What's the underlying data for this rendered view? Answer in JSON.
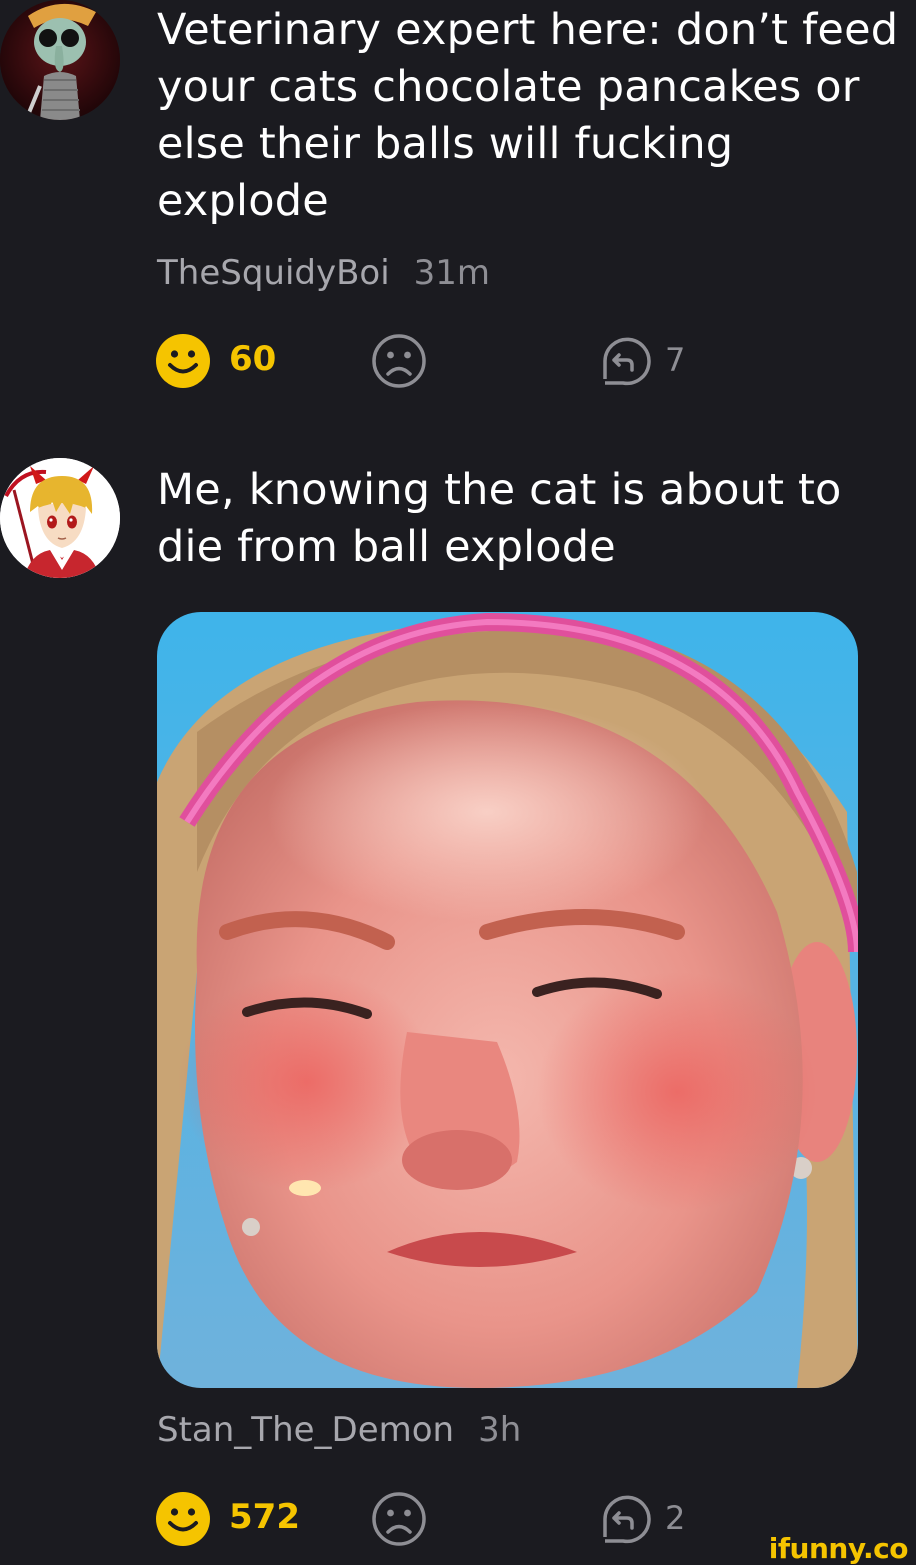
{
  "comments": [
    {
      "avatar_icon": "squidward-avatar-icon",
      "text_lines": [
        "Veterinary expert here: don’t feed",
        "your cats chocolate pancakes or",
        "else their balls will fucking",
        "explode"
      ],
      "username": "TheSquidyBoi",
      "time": "31m",
      "smiles": "60",
      "replies": "7"
    },
    {
      "avatar_icon": "anime-demon-avatar-icon",
      "text_lines": [
        "Me, knowing the cat is about to",
        "die from ball explode"
      ],
      "image_icon": "crying-girl-photo",
      "username": "Stan_The_Demon",
      "time": "3h",
      "smiles": "572",
      "replies": "2"
    }
  ],
  "watermark": "ifunny.co",
  "colors": {
    "background": "#1b1b20",
    "smile_accent": "#f5c400",
    "meta_gray": "#a7a7ad",
    "icon_gray": "#8e8e94"
  }
}
